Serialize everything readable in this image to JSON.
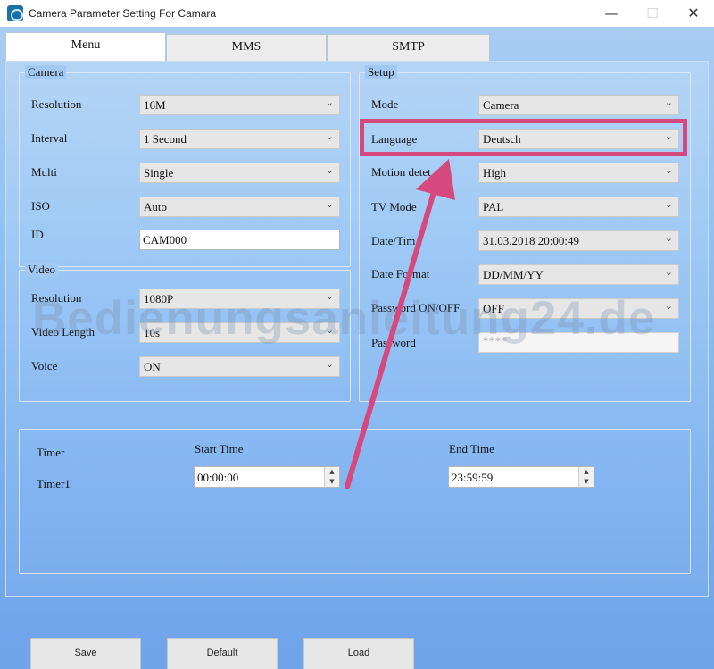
{
  "window": {
    "title": "Camera Parameter Setting For  Camara",
    "minimize_glyph": "—",
    "maximize_glyph": "☐",
    "close_glyph": "✕",
    "icon": "camera-app-icon"
  },
  "tabs": [
    {
      "label": "Menu",
      "active": true
    },
    {
      "label": "MMS",
      "active": false
    },
    {
      "label": "SMTP",
      "active": false
    }
  ],
  "camera": {
    "title": "Camera",
    "resolution": {
      "label": "Resolution",
      "value": "16M"
    },
    "interval": {
      "label": "Interval",
      "value": "1 Second"
    },
    "multi": {
      "label": "Multi",
      "value": "Single"
    },
    "iso": {
      "label": "ISO",
      "value": "Auto"
    },
    "id": {
      "label": "ID",
      "value": "CAM000"
    }
  },
  "video": {
    "title": "Video",
    "resolution": {
      "label": "Resolution",
      "value": "1080P"
    },
    "length": {
      "label": "Video Length",
      "value": "10s"
    },
    "voice": {
      "label": "Voice",
      "value": "ON"
    }
  },
  "setup": {
    "title": "Setup",
    "mode": {
      "label": "Mode",
      "value": "Camera"
    },
    "language": {
      "label": "Language",
      "value": "Deutsch"
    },
    "motion": {
      "label": "Motion detet",
      "value": "High"
    },
    "tvmode": {
      "label": "TV Mode",
      "value": "PAL"
    },
    "datetime": {
      "label": "Date/Tim",
      "value": "31.03.2018 20:00:49"
    },
    "dateformat": {
      "label": "Date Format",
      "value": "DD/MM/YY"
    },
    "password_onoff": {
      "label": "Password ON/OFF",
      "value": "OFF"
    },
    "password": {
      "label": "Password",
      "value": "****"
    }
  },
  "timer": {
    "title": "Timer",
    "start_label": "Start Time",
    "end_label": "End Time",
    "timer1_label": "Timer1",
    "start_value": "00:00:00",
    "end_value": "23:59:59"
  },
  "buttons": {
    "save": "Save",
    "default": "Default",
    "load": "Load"
  },
  "watermark": "Bedienungsanleitung24.de",
  "annotation": {
    "color": "#d6497f"
  },
  "glyphs": {
    "dropdown": "⌄",
    "spin_up": "▲",
    "spin_down": "▼"
  },
  "colors": {
    "background_top": "#a9cdf3",
    "background_bottom": "#6fa3ea"
  }
}
